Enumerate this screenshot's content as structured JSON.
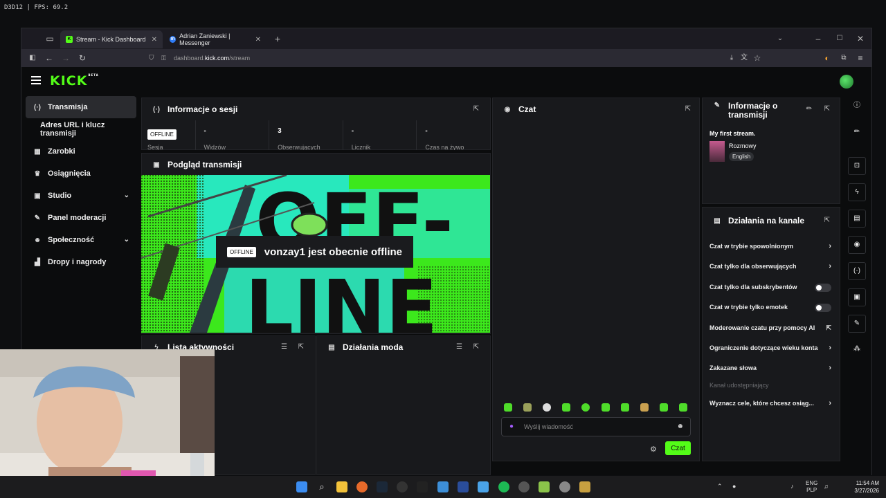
{
  "overlay": {
    "fps_text": "D3D12 | FPS:   69.2"
  },
  "browser": {
    "tabs": [
      {
        "title": "Stream - Kick Dashboard",
        "favicon": "kick-favicon",
        "active": true
      },
      {
        "title": "Adrian Zaniewski | Messenger",
        "favicon": "messenger-favicon",
        "active": false
      }
    ],
    "url_prefix": "dashboard.",
    "url_domain": "kick.com",
    "url_path": "/stream"
  },
  "header": {
    "logo_text": "KICK",
    "logo_badge": "BETA"
  },
  "sidebar": {
    "items": [
      {
        "label": "Transmisja",
        "icon": "broadcast-icon",
        "active": true
      },
      {
        "label": "Adres URL i klucz transmisji",
        "icon": "",
        "sub": true
      },
      {
        "label": "Zarobki",
        "icon": "money-icon"
      },
      {
        "label": "Osiągnięcia",
        "icon": "trophy-icon"
      },
      {
        "label": "Studio",
        "icon": "studio-icon",
        "expandable": true
      },
      {
        "label": "Panel moderacji",
        "icon": "wrench-icon"
      },
      {
        "label": "Społeczność",
        "icon": "people-icon",
        "expandable": true
      },
      {
        "label": "Dropy i nagrody",
        "icon": "chart-icon"
      }
    ]
  },
  "session": {
    "title": "Informacje o sesji",
    "status_badge": "OFFLINE",
    "status_label": "Sesja",
    "stats": [
      {
        "value": "-",
        "label": "Widzów"
      },
      {
        "value": "3",
        "label": "Obserwujących"
      },
      {
        "value": "-",
        "label": "Licznik"
      },
      {
        "value": "-",
        "label": "Czas na żywo"
      }
    ]
  },
  "preview": {
    "title": "Podgląd transmisji",
    "offline_badge": "OFFLINE",
    "offline_message": "vonzay1 jest obecnie offline",
    "art_text_top": "OFF-",
    "art_text_bottom": "LINE"
  },
  "activity": {
    "title": "Lista aktywności"
  },
  "mod_actions": {
    "title": "Działania moda"
  },
  "chat": {
    "title": "Czat",
    "input_placeholder": "Wyślij wiadomość",
    "send_label": "Czat"
  },
  "stream_info": {
    "title": "Informacje o transmisji",
    "stream_title": "My first stream.",
    "category": "Rozmowy",
    "language": "English"
  },
  "channel_actions": {
    "title": "Działania na kanale",
    "items": [
      {
        "label": "Czat w trybie spowolnionym",
        "control": "arrow"
      },
      {
        "label": "Czat tylko dla obserwujących",
        "control": "arrow"
      },
      {
        "label": "Czat tylko dla subskrybentów",
        "control": "toggle",
        "value": false
      },
      {
        "label": "Czat w trybie tylko emotek",
        "control": "toggle",
        "value": false
      },
      {
        "label": "Moderowanie czatu przy pomocy AI",
        "control": "external"
      },
      {
        "label": "Ograniczenie dotyczące wieku konta",
        "control": "arrow"
      },
      {
        "label": "Zakazane słowa",
        "control": "arrow"
      },
      {
        "label": "Kanał udostępniający",
        "control": "none",
        "disabled": true
      },
      {
        "label": "Wyznacz cele, które chcesz osiąg...",
        "control": "arrow"
      }
    ]
  },
  "taskbar": {
    "lang_line1": "ENG",
    "lang_line2": "PLP",
    "time": "11:54 AM",
    "date": "3/27/2026"
  },
  "colors": {
    "kick_green": "#53fc18",
    "panel_bg": "#18191c",
    "page_bg": "#0b0c0d"
  }
}
